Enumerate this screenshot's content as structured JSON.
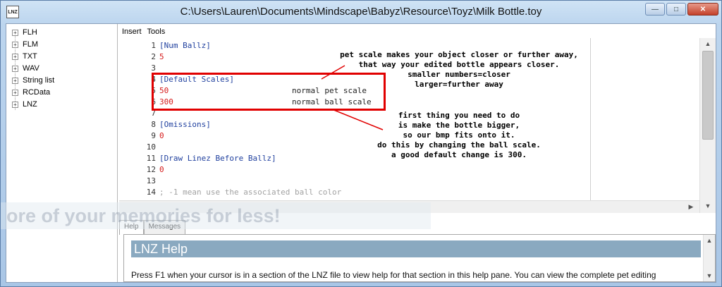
{
  "window": {
    "title": "C:\\Users\\Lauren\\Documents\\Mindscape\\Babyz\\Resource\\Toyz\\Milk Bottle.toy",
    "app_icon_text": "LNZ",
    "minimize_glyph": "—",
    "maximize_glyph": "□",
    "close_glyph": "✕"
  },
  "tree": {
    "items": [
      {
        "label": "FLH"
      },
      {
        "label": "FLM"
      },
      {
        "label": "TXT"
      },
      {
        "label": "WAV"
      },
      {
        "label": "String list"
      },
      {
        "label": "RCData"
      },
      {
        "label": "LNZ"
      }
    ],
    "expander_glyph": "+"
  },
  "menu": {
    "items": [
      "Insert",
      "Tools"
    ]
  },
  "editor": {
    "lines": [
      {
        "num": "1",
        "text": "[Num Ballz]",
        "kind": "section"
      },
      {
        "num": "2",
        "text": "5",
        "kind": "value"
      },
      {
        "num": "3",
        "text": "",
        "kind": "plain"
      },
      {
        "num": "4",
        "text": "[Default Scales]",
        "kind": "section"
      },
      {
        "num": "5",
        "text": "50",
        "kind": "value",
        "comment": "normal pet scale"
      },
      {
        "num": "6",
        "text": "300",
        "kind": "value",
        "comment": "normal ball scale"
      },
      {
        "num": "7",
        "text": "",
        "kind": "plain"
      },
      {
        "num": "8",
        "text": "[Omissions]",
        "kind": "section"
      },
      {
        "num": "9",
        "text": "0",
        "kind": "value"
      },
      {
        "num": "10",
        "text": "",
        "kind": "plain"
      },
      {
        "num": "11",
        "text": "[Draw Linez Before Ballz]",
        "kind": "section"
      },
      {
        "num": "12",
        "text": "0",
        "kind": "value"
      },
      {
        "num": "13",
        "text": "",
        "kind": "plain"
      },
      {
        "num": "14",
        "text": "; -1 mean use the associated ball color",
        "kind": "comment"
      }
    ]
  },
  "annotations": {
    "top": [
      "pet scale makes your object closer or further away,",
      "that way your edited bottle appears closer.",
      "smaller numbers=closer",
      "larger=further away"
    ],
    "bottom": [
      "first thing you need to do",
      "is make the bottle bigger,",
      "so our bmp fits onto it.",
      "do this by changing the ball scale.",
      "a good default change is 300."
    ]
  },
  "help": {
    "tabs": [
      "Help",
      "Messages"
    ],
    "heading": "LNZ Help",
    "body": "Press F1 when your cursor is in a section of the LNZ file to view help for that section in this help pane. You can view the complete pet editing"
  },
  "watermark": "ore of your memories for less!",
  "colors": {
    "section": "#1f3f9e",
    "value": "#d51b1b",
    "comment": "#a2a2a2",
    "highlight_box": "#e10000",
    "help_heading_bg": "#8aa9c0"
  }
}
